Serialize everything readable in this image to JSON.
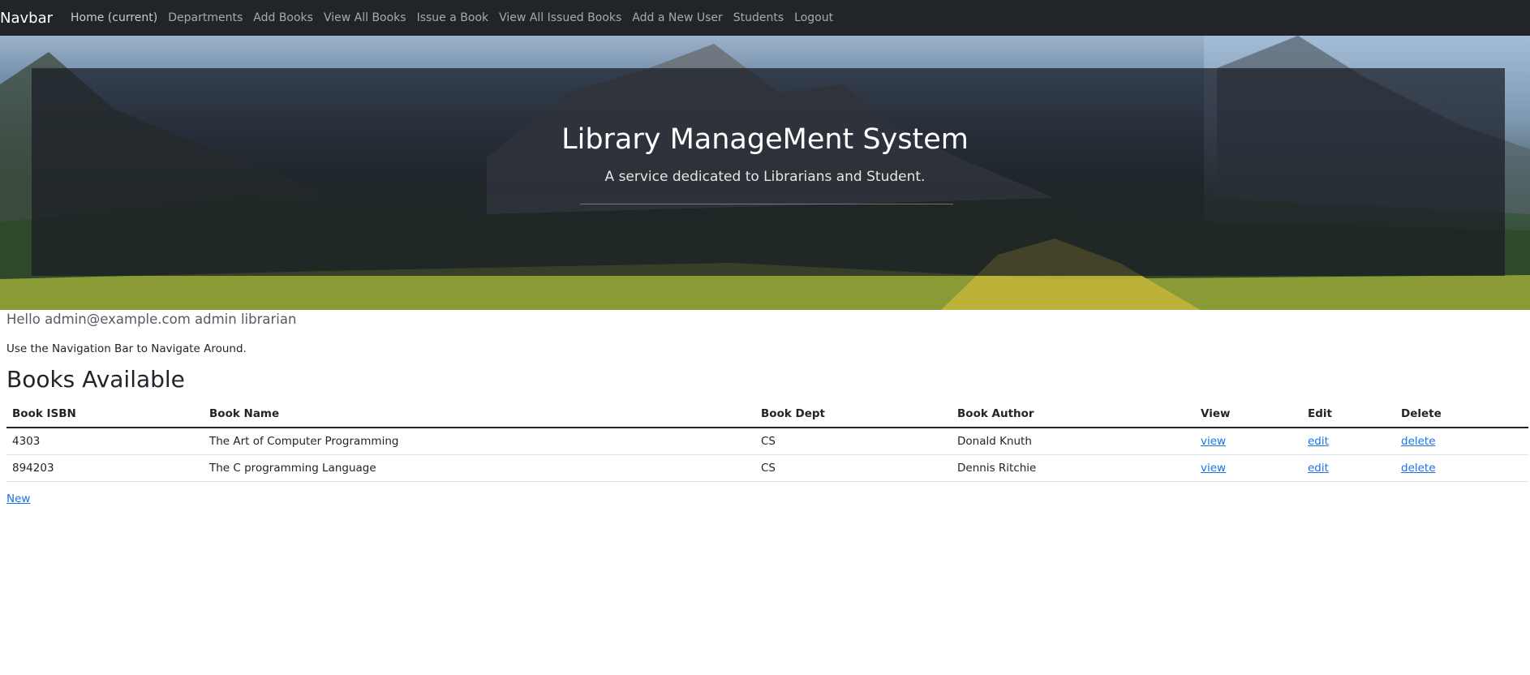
{
  "navbar": {
    "brand": "Navbar",
    "links": [
      "Home (current)",
      "Departments",
      "Add Books",
      "View All Books",
      "Issue a Book",
      "View All Issued Books",
      "Add a New User",
      "Students",
      "Logout"
    ]
  },
  "hero": {
    "title": "Library ManageMent System",
    "subtitle": "A service dedicated to Librarians and Student."
  },
  "greeting": "Hello admin@example.com admin librarian",
  "hint": "Use the Navigation Bar to Navigate Around.",
  "section_title": "Books Available",
  "table": {
    "headers": [
      "Book ISBN",
      "Book Name",
      "Book Dept",
      "Book Author",
      "View",
      "Edit",
      "Delete"
    ],
    "rows": [
      {
        "isbn": "4303",
        "name": "The Art of Computer Programming",
        "dept": "CS",
        "author": "Donald Knuth",
        "view": "view",
        "edit": "edit",
        "delete": "delete"
      },
      {
        "isbn": "894203",
        "name": "The C programming Language",
        "dept": "CS",
        "author": "Dennis Ritchie",
        "view": "view",
        "edit": "edit",
        "delete": "delete"
      }
    ]
  },
  "new_link": "New"
}
